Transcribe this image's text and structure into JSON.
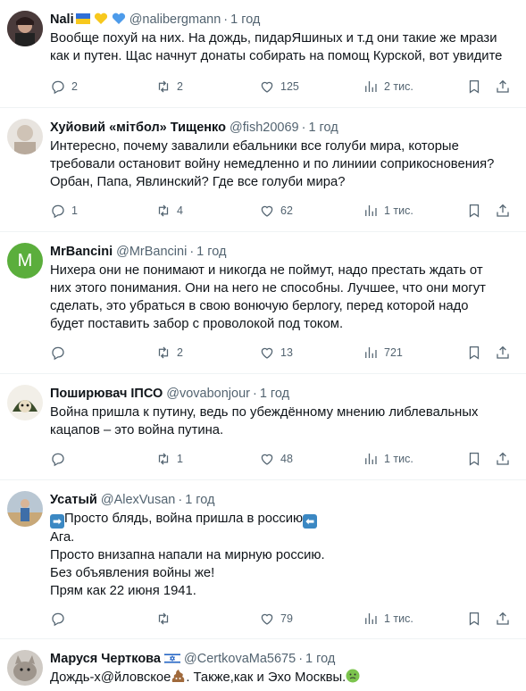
{
  "posts": [
    {
      "name": "Nali",
      "handle": "@nalibergmann",
      "time": "1 год",
      "text": "Вообще похуй на них. На дождь, пидарЯшиных и т.д они такие же мрази\nкак и путен. Щас начнут донаты собирать на помощ Курской, вот увидите",
      "replies": "2",
      "reposts": "2",
      "likes": "125",
      "views": "2 тис."
    },
    {
      "name": "Хуйовий «мітбол» Тищенко",
      "handle": "@fish20069",
      "time": "1 год",
      "text": "Интересно, почему завалили ебальники все голуби мира, которые\nтребовали остановит войну немедленно и по линиии соприкосновения?\nОрбан, Папа, Явлинский? Где все голуби мира?",
      "replies": "1",
      "reposts": "4",
      "likes": "62",
      "views": "1 тис."
    },
    {
      "name": "MrBancini",
      "handle": "@MrBancini",
      "time": "1 год",
      "avatar_letter": "M",
      "text": "Нихера они не понимают и никогда не поймут, надо престать ждать от\nних этого понимания. Они на него не способны. Лучшее, что они могут\nсделать, это убраться в свою вонючую берлогу,  перед которой надо\nбудет поставить забор с проволокой под током.",
      "replies": "",
      "reposts": "2",
      "likes": "13",
      "views": "721"
    },
    {
      "name": "Поширювач ІПСО",
      "handle": "@vovabonjour",
      "time": "1 год",
      "text": "Война пришла к путину, ведь по убеждённому мнению либлевальных\nкацапов – это война путина.",
      "replies": "",
      "reposts": "1",
      "likes": "48",
      "views": "1 тис."
    },
    {
      "name": "Усатый",
      "handle": "@AlexVusan",
      "time": "1 год",
      "text_line1": "Просто блядь, война пришла в россию",
      "text": "Ага.\nПросто внизапна напали на мирную россию.\nБез объявления войны же!\nПрям как 22 июня 1941.",
      "replies": "",
      "reposts": "",
      "likes": "79",
      "views": "1 тис."
    },
    {
      "name": "Маруся Черткова",
      "handle": "@CertkovaMa5675",
      "time": "1 год",
      "text_a": "Дождь-х@йловское",
      "text_b": ". Также,как и Эхо Москвы."
    }
  ],
  "colors": {
    "secondary_text": "#536471",
    "accent": "#1d9bf0",
    "divider": "#eff3f4",
    "avatar_green": "#5bae3c"
  },
  "icons": [
    "reply-icon",
    "repost-icon",
    "like-icon",
    "views-icon",
    "bookmark-icon",
    "share-icon"
  ]
}
